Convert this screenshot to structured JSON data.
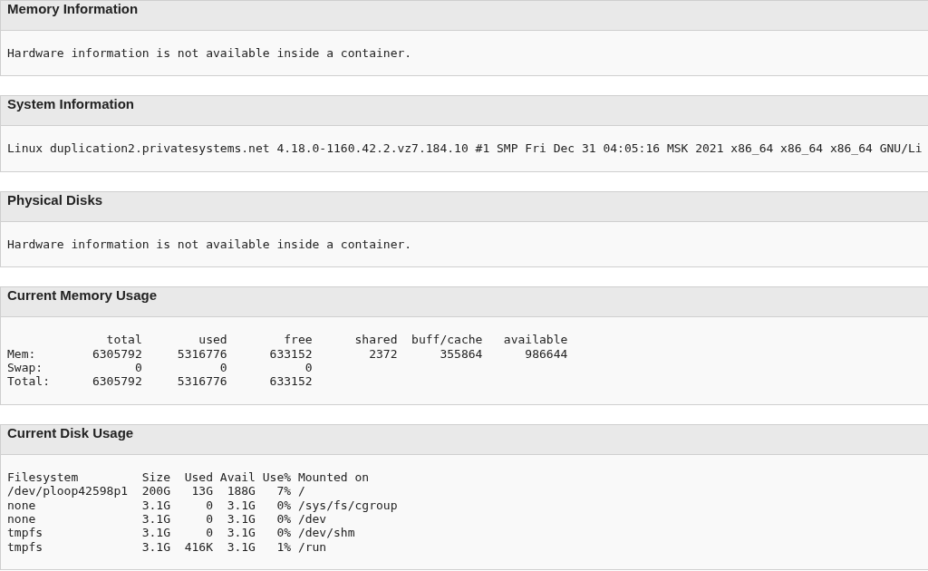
{
  "panels": [
    {
      "title": "Memory Information",
      "lines": [
        "Hardware information is not available inside a container."
      ]
    },
    {
      "title": "System Information",
      "lines": [
        "Linux duplication2.privatesystems.net 4.18.0-1160.42.2.vz7.184.10 #1 SMP Fri Dec 31 04:05:16 MSK 2021 x86_64 x86_64 x86_64 GNU/Li"
      ]
    },
    {
      "title": "Physical Disks",
      "lines": [
        "Hardware information is not available inside a container."
      ]
    },
    {
      "title": "Current Memory Usage",
      "lines": [
        "              total        used        free      shared  buff/cache   available",
        "Mem:        6305792     5316776      633152        2372      355864      986644",
        "Swap:             0           0           0",
        "Total:      6305792     5316776      633152"
      ]
    },
    {
      "title": "Current Disk Usage",
      "lines": [
        "Filesystem         Size  Used Avail Use% Mounted on",
        "/dev/ploop42598p1  200G   13G  188G   7% /",
        "none               3.1G     0  3.1G   0% /sys/fs/cgroup",
        "none               3.1G     0  3.1G   0% /dev",
        "tmpfs              3.1G     0  3.1G   0% /dev/shm",
        "tmpfs              3.1G  416K  3.1G   1% /run"
      ]
    }
  ]
}
